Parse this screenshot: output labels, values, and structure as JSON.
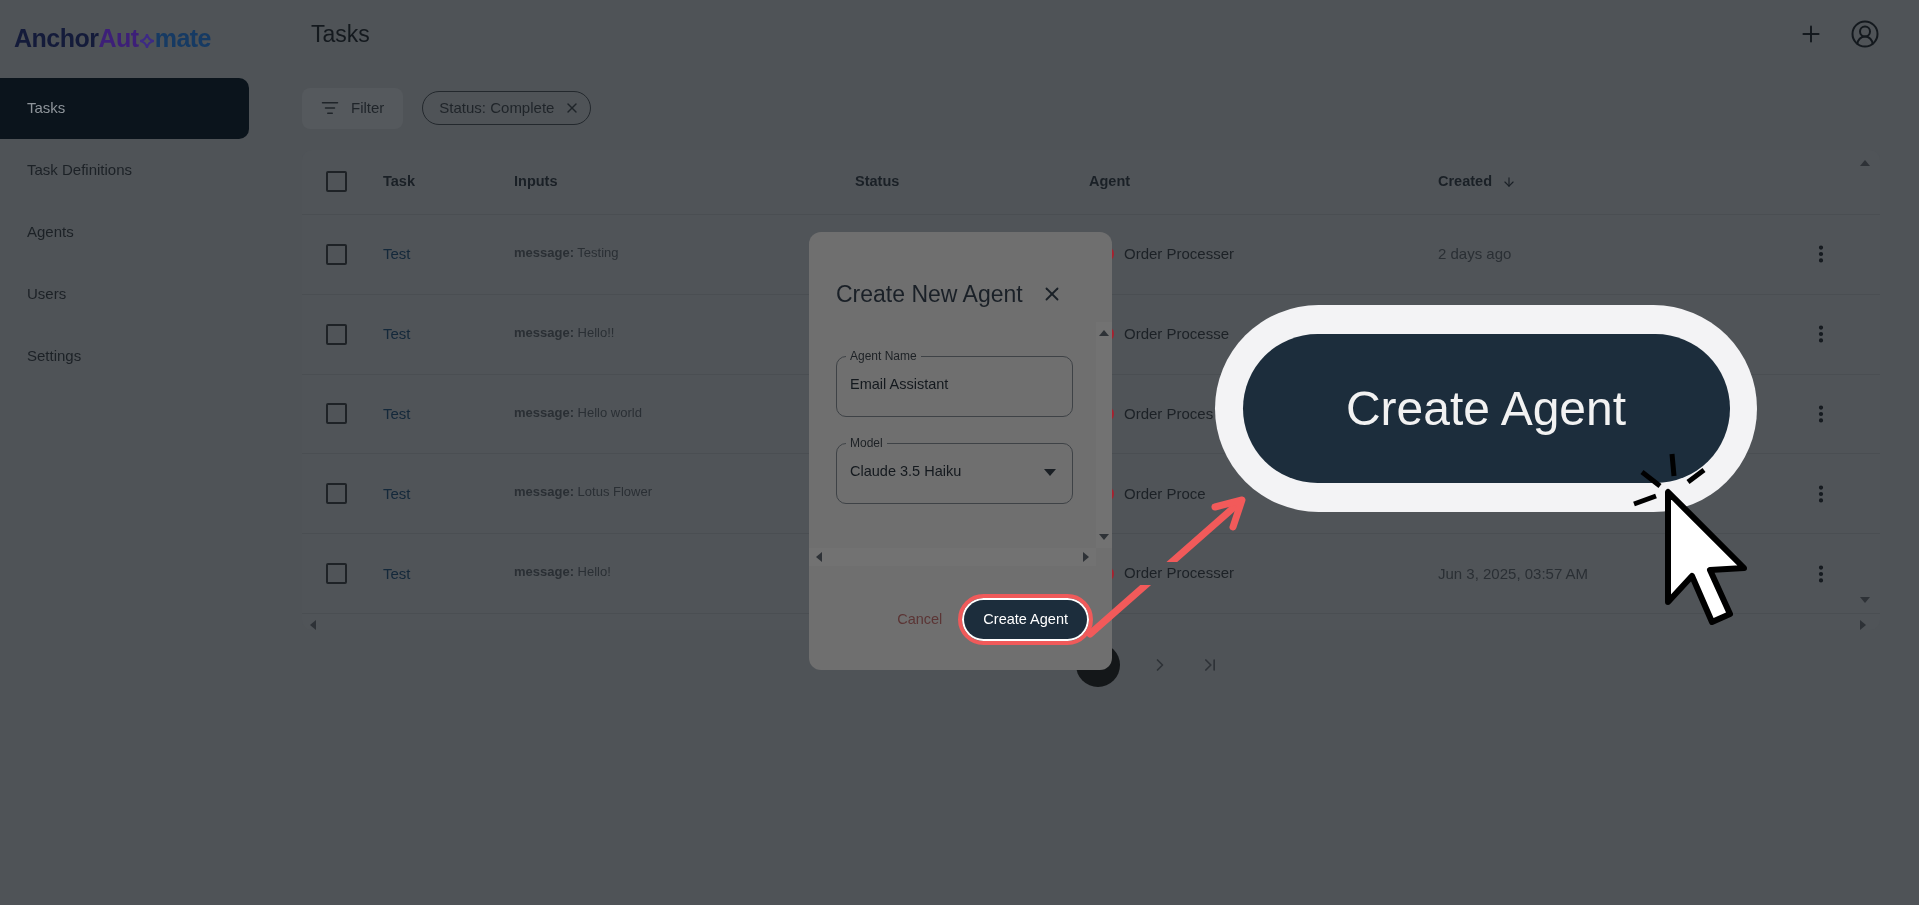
{
  "brand": {
    "first": "Anchor",
    "second": "Aut",
    "third": "mate"
  },
  "sidebar": {
    "items": [
      {
        "label": "Tasks",
        "selected": true
      },
      {
        "label": "Task Definitions",
        "selected": false
      },
      {
        "label": "Agents",
        "selected": false
      },
      {
        "label": "Users",
        "selected": false
      },
      {
        "label": "Settings",
        "selected": false
      }
    ]
  },
  "header": {
    "title": "Tasks"
  },
  "toolbar": {
    "filter_label": "Filter",
    "chips": [
      {
        "label": "Status: Complete"
      }
    ]
  },
  "table": {
    "columns": [
      {
        "label": "Task",
        "sorted": false
      },
      {
        "label": "Inputs",
        "sorted": false
      },
      {
        "label": "Status",
        "sorted": false
      },
      {
        "label": "Agent",
        "sorted": false
      },
      {
        "label": "Created",
        "sorted": true
      }
    ],
    "all_checked": false,
    "rows": [
      {
        "checked": false,
        "task": "Test",
        "input": "**message:** Testing",
        "agent": "Order Processer",
        "created": "2 days ago"
      },
      {
        "checked": false,
        "task": "Test",
        "input": "**message:** Hello!!",
        "agent": "Order Processe"
      },
      {
        "checked": false,
        "task": "Test",
        "input": "**message:** Hello world",
        "agent": "Order Proces"
      },
      {
        "checked": false,
        "task": "Test",
        "input": "**message:** Lotus Flower",
        "agent": "Order Proce"
      },
      {
        "checked": false,
        "task": "Test",
        "input": "**message:** Hello!",
        "agent": "Order Processer",
        "created": "Jun 3, 2025, 03:57 AM"
      }
    ]
  },
  "dialog": {
    "title": "Create New Agent",
    "fields": [
      {
        "kind": "text",
        "label": "Agent Name",
        "value": "Email Assistant"
      },
      {
        "kind": "select",
        "label": "Model",
        "value": "Claude 3.5 Haiku"
      }
    ],
    "cancel": "Cancel",
    "submit": "Create Agent"
  },
  "callout": {
    "label": "Create Agent"
  }
}
